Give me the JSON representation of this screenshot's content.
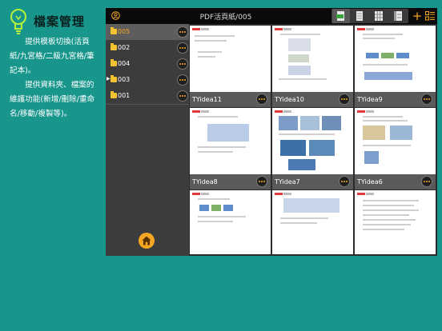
{
  "promo": {
    "title": "檔案管理",
    "line1": "提供模板切換(活頁紙/九宮格/二級九宮格/筆記本)。",
    "line2": "提供資料夾、檔案的維護功能(新增/刪除/重命名/移動/複製等)。"
  },
  "app": {
    "title": "PDF活頁紙/005",
    "add_symbol": "+",
    "view_modes": [
      "pdf-view-icon",
      "page-view-icon",
      "grid-view-icon",
      "list-view-icon"
    ],
    "active_view": 0
  },
  "sidebar": {
    "folders": [
      {
        "name": "005",
        "selected": true
      },
      {
        "name": "002",
        "selected": false
      },
      {
        "name": "004",
        "selected": false
      },
      {
        "name": "003",
        "selected": false,
        "current": true
      },
      {
        "name": "001",
        "selected": false
      }
    ]
  },
  "documents": [
    {
      "name": "TYidea11"
    },
    {
      "name": "TYidea10"
    },
    {
      "name": "TYidea9"
    },
    {
      "name": "TYidea8"
    },
    {
      "name": "TYidea7"
    },
    {
      "name": "TYidea6"
    },
    {
      "name": ""
    },
    {
      "name": ""
    },
    {
      "name": ""
    }
  ],
  "colors": {
    "background": "#18968c",
    "accent": "#f5a623",
    "folder": "#f4c430"
  }
}
